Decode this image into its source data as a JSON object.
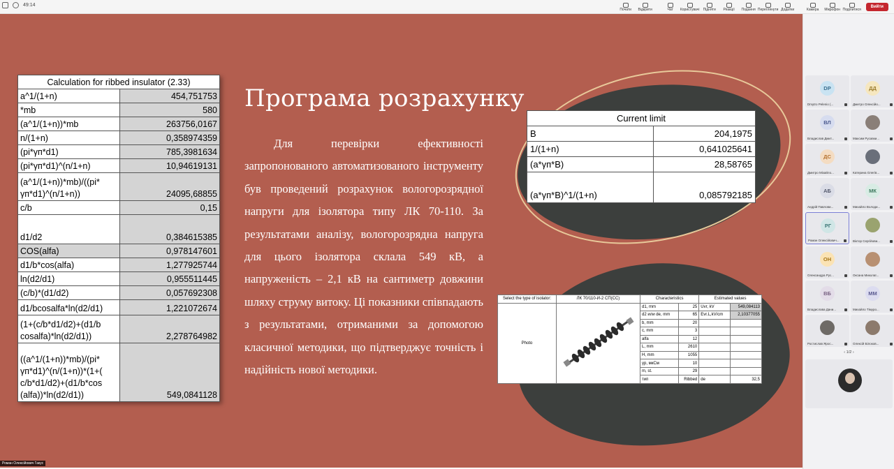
{
  "topbar": {
    "timer": "49:14",
    "tools": [
      {
        "label": "Почати"
      },
      {
        "label": "Відкрити"
      },
      {
        "label": "Чат"
      },
      {
        "label": "Користувачі",
        "badge": "22"
      },
      {
        "label": "Підняти"
      },
      {
        "label": "Реакції"
      },
      {
        "label": "Подання"
      },
      {
        "label": "Переглянути"
      },
      {
        "label": "Додатки"
      },
      {
        "label": "Камера"
      },
      {
        "label": "Мікрофон"
      },
      {
        "label": "Поділитися"
      }
    ],
    "leave_label": "Вийти"
  },
  "slide": {
    "title": "Програма розрахунку",
    "body": "Для перевірки ефективності запропонованого автоматизованого інструменту був проведений розрахунок вологорозрядної напруги для ізолятора типу ЛК 70-110. За результатами аналізу, вологорозрядна напруга для цього ізолятора склала 549 кВ, а напруженість – 2,1 кВ на сантиметр довжини шляху струму витоку. Ці показники співпадають з результатами, отриманими за допомогою класичної методики, що підтверджує точність і надійність нової методики.",
    "calc_table": {
      "title": "Calculation for ribbed insulator (2.33)",
      "rows": [
        {
          "label": "a^1/(1+n)",
          "value": "454,751753"
        },
        {
          "label": "*mb",
          "value": "580"
        },
        {
          "label": "(a^1/(1+n))*mb",
          "value": "263756,0167"
        },
        {
          "label": "n/(1+n)",
          "value": "0,358974359"
        },
        {
          "label": "(pi*γп*d1)",
          "value": "785,3981634"
        },
        {
          "label": "(pi*γп*d1)^(n/1+n)",
          "value": "10,94619131"
        },
        {
          "label": "(a^1/(1+n))*mb)/((pi* γп*d1)^(n/1+n))",
          "value": "24095,68855"
        },
        {
          "label": "c/b",
          "value": "0,15"
        },
        {
          "label": "d1/d2",
          "value": "0,384615385"
        },
        {
          "label": "COS(alfa)",
          "value": "0,978147601"
        },
        {
          "label": "d1/b*cos(alfa)",
          "value": "1,277925744"
        },
        {
          "label": "ln(d2/d1)",
          "value": "0,955511445"
        },
        {
          "label": "(c/b)*(d1/d2)",
          "value": "0,057692308"
        },
        {
          "label": "d1/bcosalfa*ln(d2/d1)",
          "value": "1,221072674"
        },
        {
          "label": "(1+(c/b*d1/d2)+(d1/b cosalfa)*ln(d2/d1))",
          "value": "2,278764982"
        },
        {
          "label": "((a^1/(1+n))*mb)/(pi* γп*d1)^(n/(1+n))*(1+( c/b*d1/d2)+(d1/b*cos (alfa))*ln(d2/d1))",
          "value": "549,0841128"
        }
      ]
    },
    "current_table": {
      "title": "Current limit",
      "rows": [
        {
          "label": "B",
          "value": "204,1975"
        },
        {
          "label": "1/(1+n)",
          "value": "0,641025641"
        },
        {
          "label": "(a*γп*B)",
          "value": "28,58765"
        },
        {
          "label": "(a*γп*B)^1/(1+n)",
          "value": "0,085792185"
        }
      ]
    },
    "isolator_table": {
      "h_select": "Select the type of isolator:",
      "h_type": "ЛК 70/110-И-2 СП(СС)",
      "h_char": "Characteristics",
      "h_est": "Estimated values",
      "photo": "Photo",
      "chars": [
        {
          "name": "d1, mm",
          "value": "25"
        },
        {
          "name": "d2 или de, mm",
          "value": "65"
        },
        {
          "name": "b, mm",
          "value": "20"
        },
        {
          "name": "c, mm",
          "value": "3"
        },
        {
          "name": "alfa",
          "value": "12"
        },
        {
          "name": "L, mm",
          "value": "2610"
        },
        {
          "name": "H, mm",
          "value": "1055"
        },
        {
          "name": "γр, мкСм",
          "value": "10"
        },
        {
          "name": "m, st.",
          "value": "29"
        },
        {
          "name": "тип",
          "value": "Ribbed"
        }
      ],
      "estimates": [
        {
          "name": "Uvr, kV",
          "value": "549,084113"
        },
        {
          "name": "Evr.L,kV/cm",
          "value": "2,10377055"
        },
        {
          "name": "de",
          "value": "32,5"
        }
      ]
    },
    "presenter": "Роман Олексійович Гакус"
  },
  "participants": {
    "tiles": [
      {
        "initials": "DP",
        "name": "Dmytro Pelenio (...",
        "bg": "#c9e3f2",
        "fg": "#3a6f8f"
      },
      {
        "initials": "ДД",
        "name": "Дмитро Олексійо...",
        "bg": "#f6e7bf",
        "fg": "#9a7a2a"
      },
      {
        "initials": "ВЛ",
        "name": "Владислав Дмит...",
        "bg": "#d6dcef",
        "fg": "#4a5a8f"
      },
      {
        "initials": "",
        "name": "Максим Русавки...",
        "bg": "#8a7f78",
        "fg": "#fff"
      },
      {
        "initials": "ДС",
        "name": "Дмитро Міхайло...",
        "bg": "#f4dcc2",
        "fg": "#b5702d"
      },
      {
        "initials": "",
        "name": "Катерина Олегів...",
        "bg": "#6a6f7a",
        "fg": "#fff"
      },
      {
        "initials": "АБ",
        "name": "Андрій Павлови...",
        "bg": "#dadce6",
        "fg": "#555a6e"
      },
      {
        "initials": "МК",
        "name": "Михайло Володи...",
        "bg": "#d8ece4",
        "fg": "#3d7a5e"
      },
      {
        "initials": "РГ",
        "name": "Роман Олексійович...",
        "bg": "#d0e6e6",
        "fg": "#3b7676"
      },
      {
        "initials": "",
        "name": "Віктор Сергійови...",
        "bg": "#9aa36f",
        "fg": "#fff"
      },
      {
        "initials": "ОН",
        "name": "Олександра Рус...",
        "bg": "#fbe3b4",
        "fg": "#a67619"
      },
      {
        "initials": "",
        "name": "Оксана Миколаї...",
        "bg": "#b89072",
        "fg": "#fff"
      },
      {
        "initials": "ВБ",
        "name": "Владислава Дани...",
        "bg": "#e3dce8",
        "fg": "#7a6384"
      },
      {
        "initials": "ММ",
        "name": "Михайло Тімуро...",
        "bg": "#dcdcf0",
        "fg": "#5a5a90"
      },
      {
        "initials": "",
        "name": "Ростислав Ярос...",
        "bg": "#6e6a66",
        "fg": "#fff"
      },
      {
        "initials": "",
        "name": "Олексій Білоков...",
        "bg": "#8c7a6c",
        "fg": "#fff"
      }
    ],
    "pager": "1/2"
  }
}
